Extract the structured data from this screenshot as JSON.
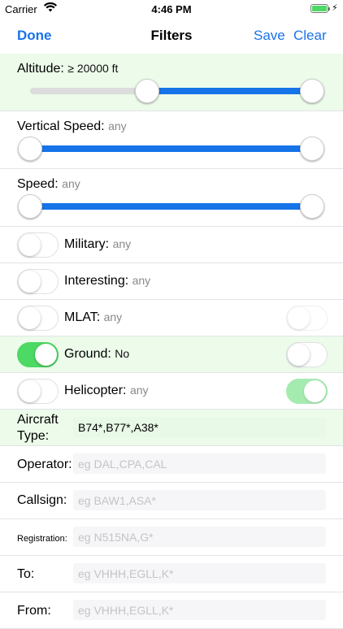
{
  "status": {
    "carrier": "Carrier",
    "time": "4:46 PM"
  },
  "nav": {
    "done": "Done",
    "title": "Filters",
    "save": "Save",
    "clear": "Clear"
  },
  "altitude": {
    "label": "Altitude:",
    "value": "≥ 20000 ft"
  },
  "vertical_speed": {
    "label": "Vertical Speed:",
    "value": "any"
  },
  "speed": {
    "label": "Speed:",
    "value": "any"
  },
  "military": {
    "label": "Military:",
    "value": "any"
  },
  "interesting": {
    "label": "Interesting:",
    "value": "any"
  },
  "mlat": {
    "label": "MLAT:",
    "value": "any"
  },
  "ground": {
    "label": "Ground:",
    "value": "No"
  },
  "helicopter": {
    "label": "Helicopter:",
    "value": "any"
  },
  "aircraft_type": {
    "label1": "Aircraft",
    "label2": "Type:",
    "value": "B74*,B77*,A38*",
    "placeholder": ""
  },
  "operator": {
    "label": "Operator:",
    "placeholder": "eg DAL,CPA,CAL"
  },
  "callsign": {
    "label": "Callsign:",
    "placeholder": "eg BAW1,ASA*"
  },
  "registration": {
    "label": "Registration:",
    "placeholder": "eg N515NA,G*"
  },
  "to": {
    "label": "To:",
    "placeholder": "eg VHHH,EGLL,K*"
  },
  "from": {
    "label": "From:",
    "placeholder": "eg VHHH,EGLL,K*"
  }
}
